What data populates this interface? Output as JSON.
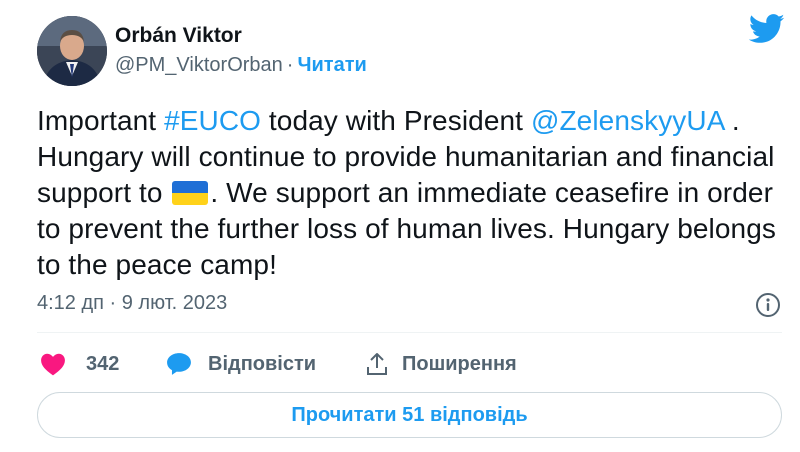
{
  "author": {
    "name": "Orbán Viktor",
    "handle": "@PM_ViktorOrban",
    "separator": "·",
    "follow_label": "Читати"
  },
  "tweet": {
    "text_parts": {
      "p1": "Important ",
      "hashtag": "#EUCO",
      "p2": " today with President ",
      "mention": "@ZelenskyyUA",
      "p3": " . Hungary will continue to provide humanitarian and financial support to ",
      "p4": ". We support an immediate ceasefire in order to prevent the further loss of human lives. Hungary belongs to the peace camp!"
    },
    "flag_emoji": "ukraine-flag",
    "timestamp": "4:12 дп · 9 лют. 2023"
  },
  "actions": {
    "like_count": "342",
    "reply_label": "Відповісти",
    "share_label": "Поширення"
  },
  "read_replies_label": "Прочитати 51 відповідь",
  "colors": {
    "accent": "#1d9bf0",
    "like": "#f91880",
    "secondary_text": "#536471",
    "flag_blue": "#1f6fd6",
    "flag_yellow": "#ffd21a"
  }
}
